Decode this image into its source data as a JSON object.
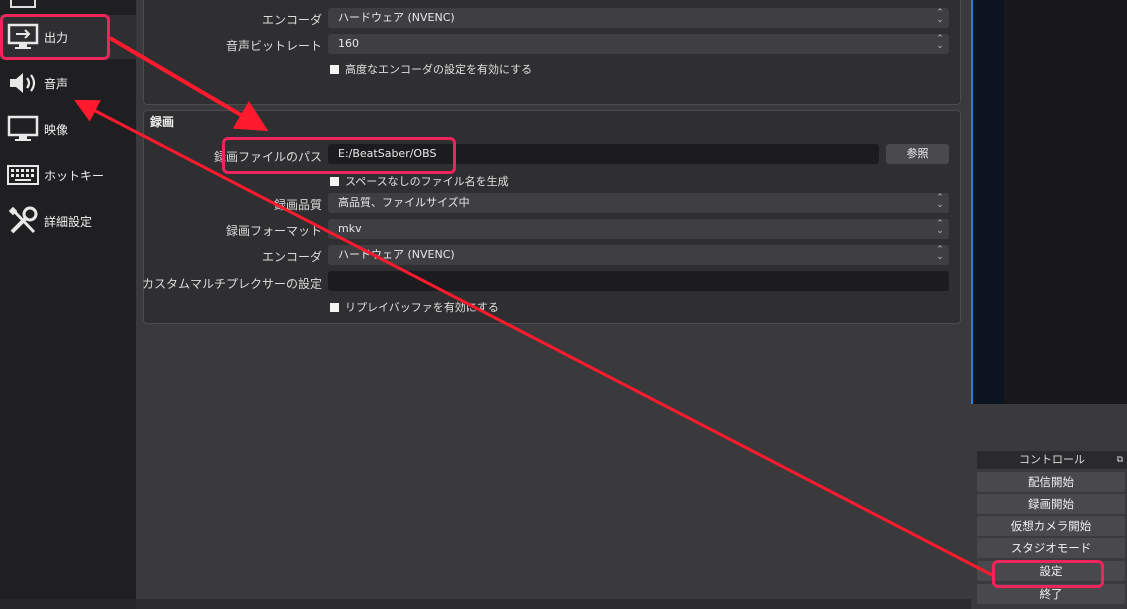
{
  "sidebar": {
    "items": [
      {
        "label": "出力",
        "icon": "monitor-output-icon"
      },
      {
        "label": "音声",
        "icon": "speaker-icon"
      },
      {
        "label": "映像",
        "icon": "monitor-icon"
      },
      {
        "label": "ホットキー",
        "icon": "keyboard-icon"
      },
      {
        "label": "詳細設定",
        "icon": "tools-icon"
      }
    ]
  },
  "streaming": {
    "encoder_label": "エンコーダ",
    "encoder_value": "ハードウェア (NVENC)",
    "audio_bitrate_label": "音声ビットレート",
    "audio_bitrate_value": "160",
    "advanced_encoder_label": "高度なエンコーダの設定を有効にする"
  },
  "recording": {
    "title": "録画",
    "path_label": "録画ファイルのパス",
    "path_value": "E:/BeatSaber/OBS",
    "browse_label": "参照",
    "no_space_label": "スペースなしのファイル名を生成",
    "quality_label": "録画品質",
    "quality_value": "高品質、ファイルサイズ中",
    "format_label": "録画フォーマット",
    "format_value": "mkv",
    "encoder_label": "エンコーダ",
    "encoder_value": "ハードウェア (NVENC)",
    "muxer_label": "カスタムマルチプレクサーの設定",
    "muxer_value": "",
    "replay_buffer_label": "リプレイバッファを有効にする"
  },
  "controls": {
    "header": "コントロール",
    "start_streaming": "配信開始",
    "start_recording": "録画開始",
    "start_virtual_cam": "仮想カメラ開始",
    "studio_mode": "スタジオモード",
    "settings": "設定",
    "exit": "終了"
  },
  "colors": {
    "highlight": "#f0245c",
    "arrow": "#ff1a2e",
    "accent": "#2d7cd6"
  }
}
